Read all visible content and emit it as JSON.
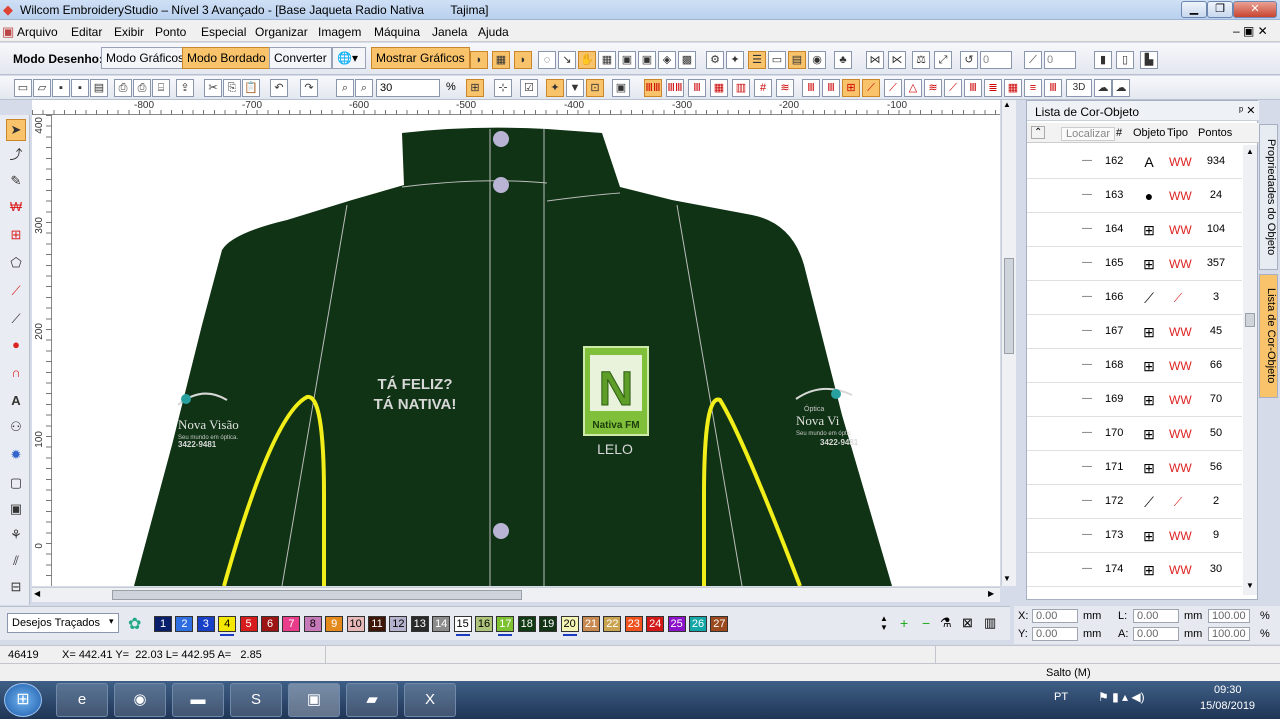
{
  "window": {
    "title": "Wilcom EmbroideryStudio – Nível 3 Avançado - [Base Jaqueta Radio Nativa        Tajima]",
    "min": "▁",
    "restore": "❐",
    "close": "✕"
  },
  "menu": [
    "Arquivo",
    "Editar",
    "Exibir",
    "Ponto",
    "Especial",
    "Organizar",
    "Imagem",
    "Máquina",
    "Janela",
    "Ajuda"
  ],
  "toolbar1": {
    "mode_label": "Modo Desenho:",
    "modo_graficos": "Modo Gráficos",
    "modo_bordado": "Modo Bordado",
    "converter": "Converter",
    "mostrar_graficos": "Mostrar Gráficos",
    "field_a": "0",
    "field_b": "0"
  },
  "toolbar2": {
    "zoom_value": "30",
    "zoom_unit": "%"
  },
  "ruler": {
    "h": [
      "-800",
      "-700",
      "-600",
      "-500",
      "-400",
      "-300",
      "-200",
      "-100"
    ],
    "v": [
      "400",
      "300",
      "200",
      "100",
      "0"
    ]
  },
  "design": {
    "text_left_1": "TÁ FELIZ?",
    "text_left_2": "TÁ NATIVA!",
    "logo_letter": "N",
    "logo_caption": "Nativa FM",
    "name": "LELO",
    "brand_left": "Nova Visão",
    "brand_left_sub": "Seu mundo em óptica.",
    "brand_left_phone": "3422-9481",
    "brand_right_top": "Óptica",
    "brand_right": "Nova Vi",
    "brand_right_sub": "Seu mundo em óptic",
    "brand_right_phone": "3422-9481",
    "jacket_color": "#0f3314",
    "seam_color": "#f2ee1a"
  },
  "panel": {
    "title": "Lista de Cor-Objeto",
    "pin": "ᵖ ✕",
    "search": "Localizar",
    "col_num": "#",
    "col_obj": "Objeto",
    "col_type": "Tipo",
    "col_pts": "Pontos",
    "rows": [
      {
        "n": "162",
        "p": "934",
        "obj": "A",
        "type": "WW"
      },
      {
        "n": "163",
        "p": "24",
        "obj": "●",
        "type": "WW"
      },
      {
        "n": "164",
        "p": "104",
        "obj": "⊞",
        "type": "WW"
      },
      {
        "n": "165",
        "p": "357",
        "obj": "⊞",
        "type": "WW"
      },
      {
        "n": "166",
        "p": "3",
        "obj": "⟋",
        "type": "⟋"
      },
      {
        "n": "167",
        "p": "45",
        "obj": "⊞",
        "type": "WW"
      },
      {
        "n": "168",
        "p": "66",
        "obj": "⊞",
        "type": "WW"
      },
      {
        "n": "169",
        "p": "70",
        "obj": "⊞",
        "type": "WW"
      },
      {
        "n": "170",
        "p": "50",
        "obj": "⊞",
        "type": "WW"
      },
      {
        "n": "171",
        "p": "56",
        "obj": "⊞",
        "type": "WW"
      },
      {
        "n": "172",
        "p": "2",
        "obj": "⟋",
        "type": "⟋"
      },
      {
        "n": "173",
        "p": "9",
        "obj": "⊞",
        "type": "WW"
      },
      {
        "n": "174",
        "p": "30",
        "obj": "⊞",
        "type": "WW"
      }
    ],
    "tab1": "Propriedades do Objeto",
    "tab2": "Lista de Cor-Objeto"
  },
  "colorbar": {
    "select": "Desejos Traçados",
    "swatches": [
      {
        "n": "1",
        "c": "#0a1f6b"
      },
      {
        "n": "2",
        "c": "#2e6ee0"
      },
      {
        "n": "3",
        "c": "#1740c7"
      },
      {
        "n": "4",
        "c": "#f5e800"
      },
      {
        "n": "5",
        "c": "#d61c1c"
      },
      {
        "n": "6",
        "c": "#9c1414"
      },
      {
        "n": "7",
        "c": "#e93d8c"
      },
      {
        "n": "8",
        "c": "#c679b9"
      },
      {
        "n": "9",
        "c": "#e48a1d"
      },
      {
        "n": "10",
        "c": "#e8b9b9"
      },
      {
        "n": "11",
        "c": "#3d1608"
      },
      {
        "n": "12",
        "c": "#b5b2cf"
      },
      {
        "n": "13",
        "c": "#2a2a2a"
      },
      {
        "n": "14",
        "c": "#8c8c8c"
      },
      {
        "n": "15",
        "c": "#ffffff"
      },
      {
        "n": "16",
        "c": "#aec47a"
      },
      {
        "n": "17",
        "c": "#7ec232"
      },
      {
        "n": "18",
        "c": "#0f3a14"
      },
      {
        "n": "19",
        "c": "#123316"
      },
      {
        "n": "20",
        "c": "#f4f4b4"
      },
      {
        "n": "21",
        "c": "#c98a52"
      },
      {
        "n": "22",
        "c": "#c9a34f"
      },
      {
        "n": "23",
        "c": "#f0521f"
      },
      {
        "n": "24",
        "c": "#d21818"
      },
      {
        "n": "25",
        "c": "#8b12c8"
      },
      {
        "n": "26",
        "c": "#14a7a7"
      },
      {
        "n": "27",
        "c": "#9a4a1e"
      }
    ]
  },
  "coords": {
    "x_label": "X:",
    "y_label": "Y:",
    "l_label": "L:",
    "a_label": "A:",
    "x": "0.00",
    "y": "0.00",
    "l": "0.00",
    "a": "0.00",
    "unit": "mm",
    "sx": "100.00",
    "sy": "100.00",
    "pct": "%"
  },
  "status": {
    "stitches": "46419",
    "position": "X= 442.41 Y=  22.03 L= 442.95 A=   2.85",
    "mode": "Salto (M)"
  },
  "taskbar": {
    "lang": "PT",
    "time": "09:30",
    "date": "15/08/2019"
  }
}
